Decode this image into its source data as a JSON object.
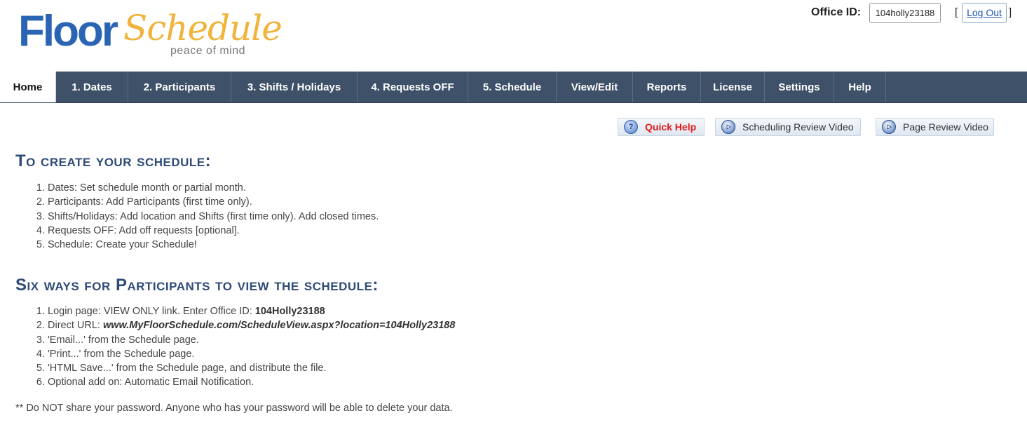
{
  "logo": {
    "primary": "Floor",
    "script": "Schedule",
    "tagline": "peace of mind"
  },
  "header": {
    "office_id_label": "Office ID:",
    "office_id_value": "104holly23188",
    "bracket_open": "[",
    "bracket_close": "]",
    "logout_label": "Log Out"
  },
  "nav": {
    "tabs": [
      {
        "label": "Home",
        "active": true
      },
      {
        "label": "1.  Dates"
      },
      {
        "label": "2.  Participants"
      },
      {
        "label": "3.  Shifts / Holidays"
      },
      {
        "label": "4.  Requests OFF"
      },
      {
        "label": "5.  Schedule"
      },
      {
        "label": "View/Edit"
      },
      {
        "label": "Reports"
      },
      {
        "label": "License"
      },
      {
        "label": "Settings"
      },
      {
        "label": "Help"
      }
    ]
  },
  "help_buttons": {
    "quick_help": "Quick Help",
    "scheduling_video": "Scheduling Review Video",
    "page_video": "Page Review Video"
  },
  "create": {
    "heading": "To create your schedule:",
    "steps": [
      "Dates: Set schedule month or partial month.",
      "Participants: Add Participants (first time only).",
      "Shifts/Holidays: Add location and Shifts (first time only). Add closed times.",
      "Requests OFF: Add off requests [optional].",
      "Schedule: Create your Schedule!"
    ]
  },
  "view": {
    "heading": "Six ways for Participants to view the schedule:",
    "login_text": "Login page: VIEW ONLY link. Enter Office ID: ",
    "login_id": "104Holly23188",
    "url_text": "Direct URL: ",
    "url_value": "www.MyFloorSchedule.com/ScheduleView.aspx?location=104Holly23188",
    "email": "'Email...' from the Schedule page.",
    "print": "'Print...' from the Schedule page.",
    "html_save": "'HTML Save...' from the Schedule page, and distribute the file.",
    "optional": "Optional add on: Automatic Email Notification."
  },
  "note": "** Do NOT share your password. Anyone who has your password will be able to delete your data.",
  "colors": {
    "nav_bg": "#3e5169",
    "heading": "#2f4b78",
    "logo_blue": "#2a64b4",
    "logo_orange": "#f2b33d",
    "quick_help_red": "#e21b1b"
  }
}
